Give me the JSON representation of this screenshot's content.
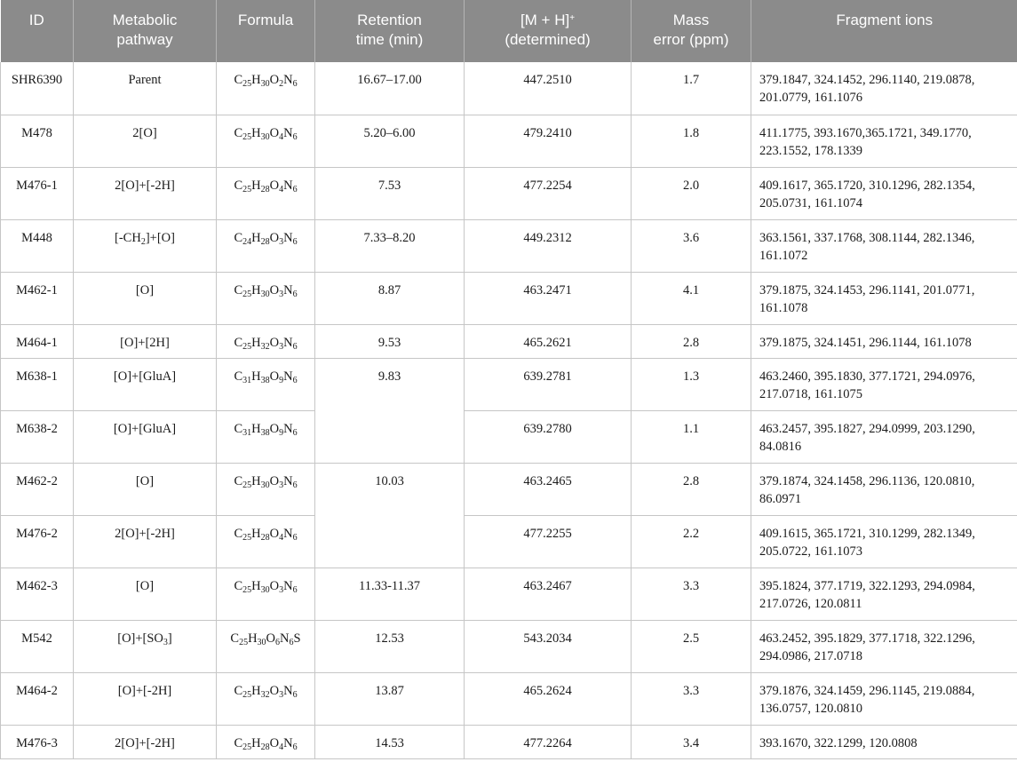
{
  "header": {
    "id": "ID",
    "pathway_line1": "Metabolic",
    "pathway_line2": "pathway",
    "formula": "Formula",
    "rt_line1": "Retention",
    "rt_line2": "time (min)",
    "mh_line1_pre": "[M + H]",
    "mh_line1_sup": "+",
    "mh_line2": "(determined)",
    "err_line1": "Mass",
    "err_line2": "error (ppm)",
    "fragments": "Fragment ions"
  },
  "rows": [
    {
      "id": "SHR6390",
      "pathway": "Parent",
      "rt": "16.67–17.00",
      "mh": "447.2510",
      "err": "1.7",
      "frag": "379.1847, 324.1452, 296.1140, 219.0878, 201.0779, 161.1076"
    },
    {
      "id": "M478",
      "pathway": "2[O]",
      "rt": "5.20–6.00",
      "mh": "479.2410",
      "err": "1.8",
      "frag": "411.1775, 393.1670,365.1721, 349.1770, 223.1552, 178.1339"
    },
    {
      "id": "M476-1",
      "pathway": "2[O]+[-2H]",
      "rt": "7.53",
      "mh": "477.2254",
      "err": "2.0",
      "frag": "409.1617, 365.1720, 310.1296, 282.1354, 205.0731, 161.1074"
    },
    {
      "id": "M448",
      "pathway_pre": "[-CH",
      "pathway_sub": "2",
      "pathway_post": "]+[O]",
      "rt": "7.33–8.20",
      "mh": "449.2312",
      "err": "3.6",
      "frag": "363.1561, 337.1768, 308.1144, 282.1346, 161.1072"
    },
    {
      "id": "M462-1",
      "pathway": "[O]",
      "rt": "8.87",
      "mh": "463.2471",
      "err": "4.1",
      "frag": "379.1875, 324.1453, 296.1141, 201.0771, 161.1078"
    },
    {
      "id": "M464-1",
      "pathway": "[O]+[2H]",
      "rt": "9.53",
      "mh": "465.2621",
      "err": "2.8",
      "frag": "379.1875, 324.1451, 296.1144, 161.1078"
    },
    {
      "id": "M638-1",
      "pathway": "[O]+[GluA]",
      "rt": "9.83",
      "mh": "639.2781",
      "err": "1.3",
      "frag": "463.2460, 395.1830, 377.1721, 294.0976, 217.0718, 161.1075"
    },
    {
      "id": "M638-2",
      "pathway": "[O]+[GluA]",
      "mh": "639.2780",
      "err": "1.1",
      "frag": "463.2457, 395.1827, 294.0999, 203.1290, 84.0816"
    },
    {
      "id": "M462-2",
      "pathway": "[O]",
      "rt": "10.03",
      "mh": "463.2465",
      "err": "2.8",
      "frag": "379.1874, 324.1458, 296.1136, 120.0810, 86.0971"
    },
    {
      "id": "M476-2",
      "pathway": "2[O]+[-2H]",
      "mh": "477.2255",
      "err": "2.2",
      "frag": "409.1615, 365.1721, 310.1299, 282.1349, 205.0722, 161.1073"
    },
    {
      "id": "M462-3",
      "pathway": "[O]",
      "rt": "11.33-11.37",
      "mh": "463.2467",
      "err": "3.3",
      "frag": "395.1824, 377.1719, 322.1293, 294.0984, 217.0726, 120.0811"
    },
    {
      "id": "M542",
      "pathway_pre": "[O]+[SO",
      "pathway_sub": "3",
      "pathway_post": "]",
      "rt": "12.53",
      "mh": "543.2034",
      "err": "2.5",
      "frag": "463.2452, 395.1829, 377.1718, 322.1296, 294.0986, 217.0718"
    },
    {
      "id": "M464-2",
      "pathway": "[O]+[-2H]",
      "rt": "13.87",
      "mh": "465.2624",
      "err": "3.3",
      "frag": "379.1876, 324.1459, 296.1145, 219.0884, 136.0757, 120.0810"
    },
    {
      "id": "M476-3",
      "pathway": "2[O]+[-2H]",
      "rt": "14.53",
      "mh": "477.2264",
      "err": "3.4",
      "frag": "393.1670, 322.1299, 120.0808"
    }
  ],
  "formulas": [
    {
      "parts": [
        [
          "C",
          ""
        ],
        [
          "25",
          "sub"
        ],
        [
          "H",
          ""
        ],
        [
          "30",
          "sub"
        ],
        [
          "O",
          ""
        ],
        [
          "2",
          "sub"
        ],
        [
          "N",
          ""
        ],
        [
          "6",
          "sub"
        ]
      ]
    },
    {
      "parts": [
        [
          "C",
          ""
        ],
        [
          "25",
          "sub"
        ],
        [
          "H",
          ""
        ],
        [
          "30",
          "sub"
        ],
        [
          "O",
          ""
        ],
        [
          "4",
          "sub"
        ],
        [
          "N",
          ""
        ],
        [
          "6",
          "sub"
        ]
      ]
    },
    {
      "parts": [
        [
          "C",
          ""
        ],
        [
          "25",
          "sub"
        ],
        [
          "H",
          ""
        ],
        [
          "28",
          "sub"
        ],
        [
          "O",
          ""
        ],
        [
          "4",
          "sub"
        ],
        [
          "N",
          ""
        ],
        [
          "6",
          "sub"
        ]
      ]
    },
    {
      "parts": [
        [
          "C",
          ""
        ],
        [
          "24",
          "sub"
        ],
        [
          "H",
          ""
        ],
        [
          "28",
          "sub"
        ],
        [
          "O",
          ""
        ],
        [
          "3",
          "sub"
        ],
        [
          "N",
          ""
        ],
        [
          "6",
          "sub"
        ]
      ]
    },
    {
      "parts": [
        [
          "C",
          ""
        ],
        [
          "25",
          "sub"
        ],
        [
          "H",
          ""
        ],
        [
          "30",
          "sub"
        ],
        [
          "O",
          ""
        ],
        [
          "3",
          "sub"
        ],
        [
          "N",
          ""
        ],
        [
          "6",
          "sub"
        ]
      ]
    },
    {
      "parts": [
        [
          "C",
          ""
        ],
        [
          "25",
          "sub"
        ],
        [
          "H",
          ""
        ],
        [
          "32",
          "sub"
        ],
        [
          "O",
          ""
        ],
        [
          "3",
          "sub"
        ],
        [
          "N",
          ""
        ],
        [
          "6",
          "sub"
        ]
      ]
    },
    {
      "parts": [
        [
          "C",
          ""
        ],
        [
          "31",
          "sub"
        ],
        [
          "H",
          ""
        ],
        [
          "38",
          "sub"
        ],
        [
          "O",
          ""
        ],
        [
          "9",
          "sub"
        ],
        [
          "N",
          ""
        ],
        [
          "6",
          "sub"
        ]
      ]
    },
    {
      "parts": [
        [
          "C",
          ""
        ],
        [
          "31",
          "sub"
        ],
        [
          "H",
          ""
        ],
        [
          "38",
          "sub"
        ],
        [
          "O",
          ""
        ],
        [
          "9",
          "sub"
        ],
        [
          "N",
          ""
        ],
        [
          "6",
          "sub"
        ]
      ]
    },
    {
      "parts": [
        [
          "C",
          ""
        ],
        [
          "25",
          "sub"
        ],
        [
          "H",
          ""
        ],
        [
          "30",
          "sub"
        ],
        [
          "O",
          ""
        ],
        [
          "3",
          "sub"
        ],
        [
          "N",
          ""
        ],
        [
          "6",
          "sub"
        ]
      ]
    },
    {
      "parts": [
        [
          "C",
          ""
        ],
        [
          "25",
          "sub"
        ],
        [
          "H",
          ""
        ],
        [
          "28",
          "sub"
        ],
        [
          "O",
          ""
        ],
        [
          "4",
          "sub"
        ],
        [
          "N",
          ""
        ],
        [
          "6",
          "sub"
        ]
      ]
    },
    {
      "parts": [
        [
          "C",
          ""
        ],
        [
          "25",
          "sub"
        ],
        [
          "H",
          ""
        ],
        [
          "30",
          "sub"
        ],
        [
          "O",
          ""
        ],
        [
          "3",
          "sub"
        ],
        [
          "N",
          ""
        ],
        [
          "6",
          "sub"
        ]
      ]
    },
    {
      "parts": [
        [
          "C",
          ""
        ],
        [
          "25",
          "sub"
        ],
        [
          "H",
          ""
        ],
        [
          "30",
          "sub"
        ],
        [
          "O",
          ""
        ],
        [
          "6",
          "sub"
        ],
        [
          "N",
          ""
        ],
        [
          "6",
          "sub"
        ],
        [
          "S",
          ""
        ]
      ]
    },
    {
      "parts": [
        [
          "C",
          ""
        ],
        [
          "25",
          "sub"
        ],
        [
          "H",
          ""
        ],
        [
          "32",
          "sub"
        ],
        [
          "O",
          ""
        ],
        [
          "3",
          "sub"
        ],
        [
          "N",
          ""
        ],
        [
          "6",
          "sub"
        ]
      ]
    },
    {
      "parts": [
        [
          "C",
          ""
        ],
        [
          "25",
          "sub"
        ],
        [
          "H",
          ""
        ],
        [
          "28",
          "sub"
        ],
        [
          "O",
          ""
        ],
        [
          "4",
          "sub"
        ],
        [
          "N",
          ""
        ],
        [
          "6",
          "sub"
        ]
      ]
    }
  ]
}
